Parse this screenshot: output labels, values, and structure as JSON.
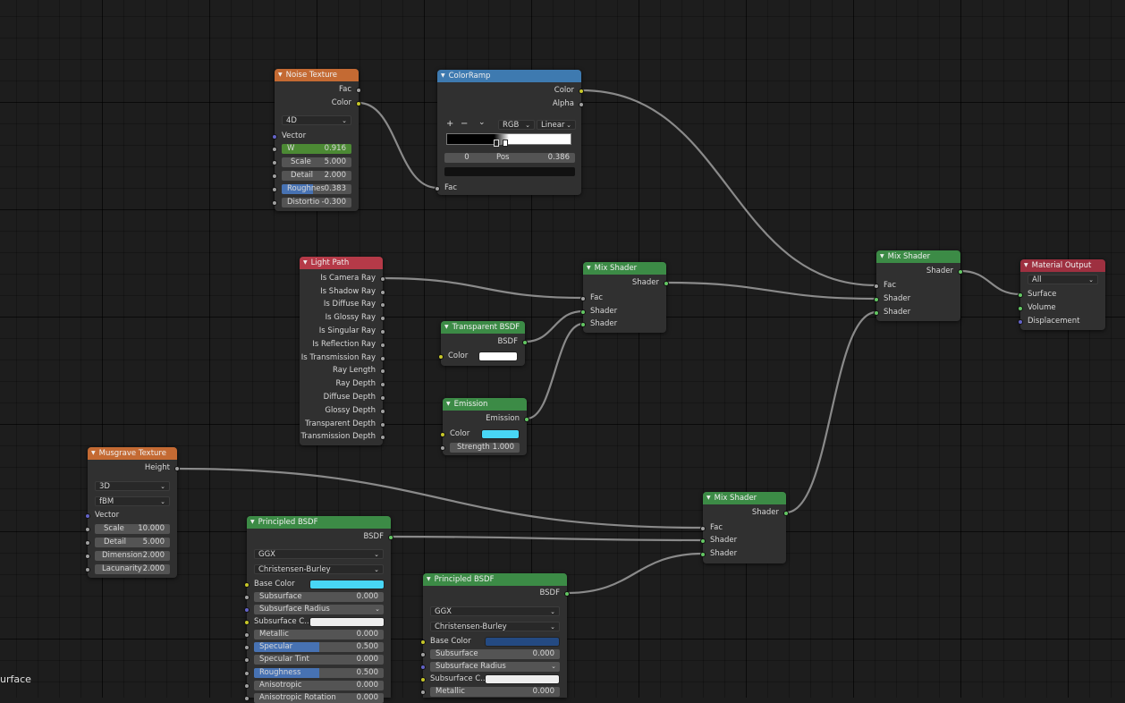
{
  "noise": {
    "title": "Noise Texture",
    "fac": "Fac",
    "color": "Color",
    "dim": "4D",
    "vector": "Vector",
    "w": {
      "label": "W",
      "value": "0.916"
    },
    "scale": {
      "label": "Scale",
      "value": "5.000"
    },
    "detail": {
      "label": "Detail",
      "value": "2.000"
    },
    "rough": {
      "label": "Roughnes",
      "value": "0.383"
    },
    "distort": {
      "label": "Distortio",
      "value": "-0.300"
    }
  },
  "ramp": {
    "title": "ColorRamp",
    "color": "Color",
    "alpha": "Alpha",
    "plus": "+",
    "minus": "−",
    "menu": "⌄",
    "mode": "RGB",
    "interp": "Linear",
    "index": "0",
    "pos_label": "Pos",
    "pos_value": "0.386",
    "fac": "Fac"
  },
  "lightpath": {
    "title": "Light Path",
    "outputs": [
      "Is Camera Ray",
      "Is Shadow Ray",
      "Is Diffuse Ray",
      "Is Glossy Ray",
      "Is Singular Ray",
      "Is Reflection Ray",
      "Is Transmission Ray",
      "Ray Length",
      "Ray Depth",
      "Diffuse Depth",
      "Glossy Depth",
      "Transparent Depth",
      "Transmission Depth"
    ]
  },
  "mix1": {
    "title": "Mix Shader",
    "shader_out": "Shader",
    "fac": "Fac",
    "shader1": "Shader",
    "shader2": "Shader"
  },
  "transp": {
    "title": "Transparent BSDF",
    "bsdf": "BSDF",
    "color": "Color"
  },
  "emission": {
    "title": "Emission",
    "out": "Emission",
    "color": "Color",
    "strength": {
      "label": "Strength",
      "value": "1.000"
    }
  },
  "mix2": {
    "title": "Mix Shader",
    "shader_out": "Shader",
    "fac": "Fac",
    "shader1": "Shader",
    "shader2": "Shader"
  },
  "output": {
    "title": "Material Output",
    "target": "All",
    "surface": "Surface",
    "volume": "Volume",
    "displacement": "Displacement"
  },
  "musgrave": {
    "title": "Musgrave Texture",
    "height": "Height",
    "dim": "3D",
    "type": "fBM",
    "vector": "Vector",
    "scale": {
      "label": "Scale",
      "value": "10.000"
    },
    "detail": {
      "label": "Detail",
      "value": "5.000"
    },
    "dimension": {
      "label": "Dimension",
      "value": "2.000"
    },
    "lacunarity": {
      "label": "Lacunarity",
      "value": "2.000"
    }
  },
  "mix3": {
    "title": "Mix Shader",
    "shader_out": "Shader",
    "fac": "Fac",
    "shader1": "Shader",
    "shader2": "Shader"
  },
  "pbsdf1": {
    "title": "Principled BSDF",
    "bsdf": "BSDF",
    "dist": "GGX",
    "sss_method": "Christensen-Burley",
    "base_color": "Base Color",
    "subsurface": {
      "label": "Subsurface",
      "value": "0.000"
    },
    "sss_radius": "Subsurface Radius",
    "sss_color": "Subsurface C...",
    "metallic": {
      "label": "Metallic",
      "value": "0.000"
    },
    "specular": {
      "label": "Specular",
      "value": "0.500"
    },
    "spec_tint": {
      "label": "Specular Tint",
      "value": "0.000"
    },
    "roughness": {
      "label": "Roughness",
      "value": "0.500"
    },
    "aniso": {
      "label": "Anisotropic",
      "value": "0.000"
    },
    "aniso_rot": {
      "label": "Anisotropic Rotation",
      "value": "0.000"
    }
  },
  "pbsdf2": {
    "title": "Principled BSDF",
    "bsdf": "BSDF",
    "dist": "GGX",
    "sss_method": "Christensen-Burley",
    "base_color": "Base Color",
    "subsurface": {
      "label": "Subsurface",
      "value": "0.000"
    },
    "sss_radius": "Subsurface Radius",
    "sss_color": "Subsurface C...",
    "metallic": {
      "label": "Metallic",
      "value": "0.000"
    }
  },
  "corner_text": "urface",
  "colors": {
    "texture_header": "#c46a33",
    "converter_header": "#3e7ab0",
    "input_header": "#b53a48",
    "shader_header": "#3c8b46",
    "output_header": "#9e3040",
    "emission_color": "#48d6f5",
    "pbsdf1_base": "#48d6f5",
    "pbsdf2_base": "#244a82",
    "transparent_color": "#ffffff"
  }
}
